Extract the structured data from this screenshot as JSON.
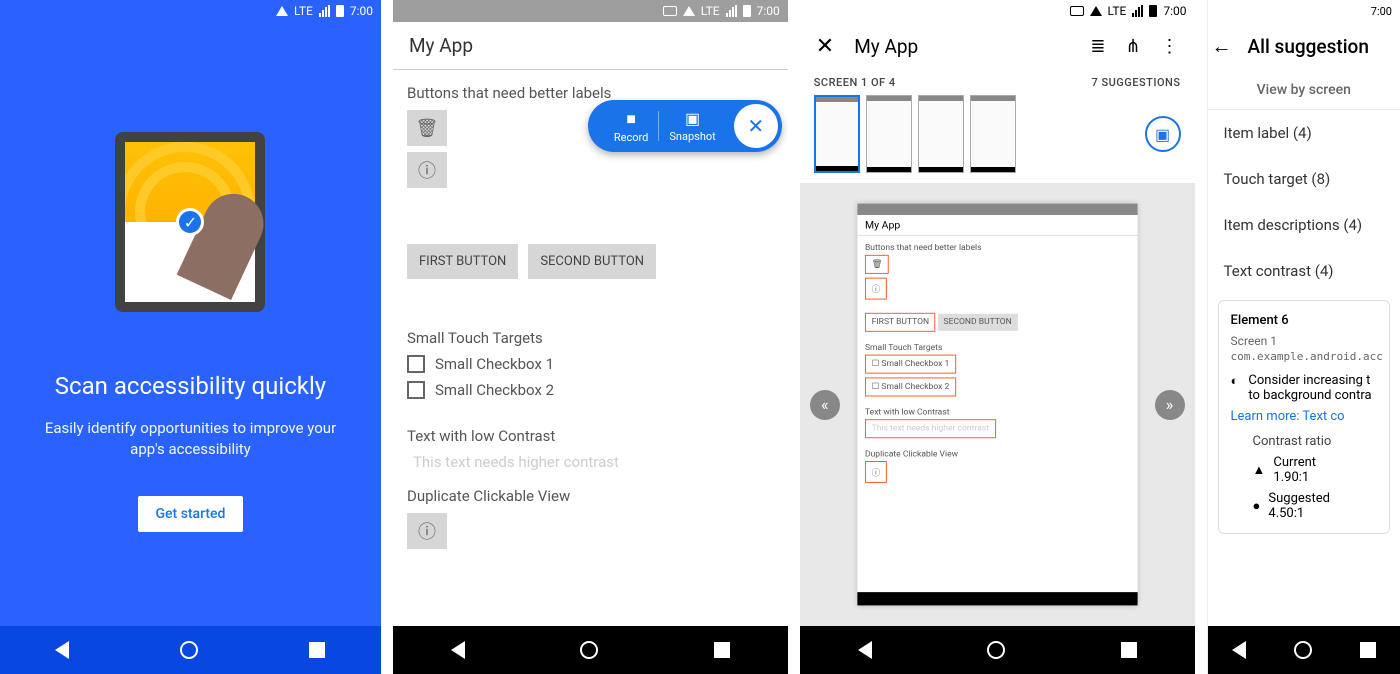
{
  "status_time": "7:00",
  "lte": "LTE",
  "screen1": {
    "title": "Scan accessibility quickly",
    "subtitle": "Easily identify opportunities to improve your app's accessibility",
    "button": "Get started"
  },
  "screen2": {
    "app_title": "My App",
    "sec1": "Buttons that need better labels",
    "btn1": "FIRST BUTTON",
    "btn2": "SECOND BUTTON",
    "sec2": "Small Touch Targets",
    "cb1": "Small Checkbox 1",
    "cb2": "Small Checkbox 2",
    "sec3": "Text with low Contrast",
    "low_text": "This text needs higher contrast",
    "sec4": "Duplicate Clickable View",
    "fab": {
      "record": "Record",
      "snapshot": "Snapshot"
    }
  },
  "screen3": {
    "app_title": "My App",
    "screen_label": "SCREEN 1 OF 4",
    "suggestions": "7 SUGGESTIONS",
    "mini": {
      "title": "My App",
      "sec1": "Buttons that need better labels",
      "btn1": "FIRST BUTTON",
      "btn2": "SECOND BUTTON",
      "sec2": "Small Touch Targets",
      "cb1": "Small Checkbox 1",
      "cb2": "Small Checkbox 2",
      "sec3": "Text with low Contrast",
      "low": "This text needs higher contrast",
      "sec4": "Duplicate Clickable View"
    }
  },
  "screen4": {
    "title": "All suggestion",
    "tab": "View by screen",
    "cats": {
      "item_label": "Item label  (4)",
      "touch_target": "Touch target  (8)",
      "item_desc": "Item descriptions  (4)",
      "text_contrast": "Text contrast  (4)"
    },
    "card": {
      "element": "Element 6",
      "screen": "Screen 1",
      "pkg": "com.example.android.acc",
      "suggestion": "Consider increasing t to background contra",
      "learn": "Learn more: Text co",
      "metric_title": "Contrast ratio",
      "current_label": "Current",
      "current_val": "1.90:1",
      "suggested_label": "Suggested",
      "suggested_val": "4.50:1"
    }
  }
}
